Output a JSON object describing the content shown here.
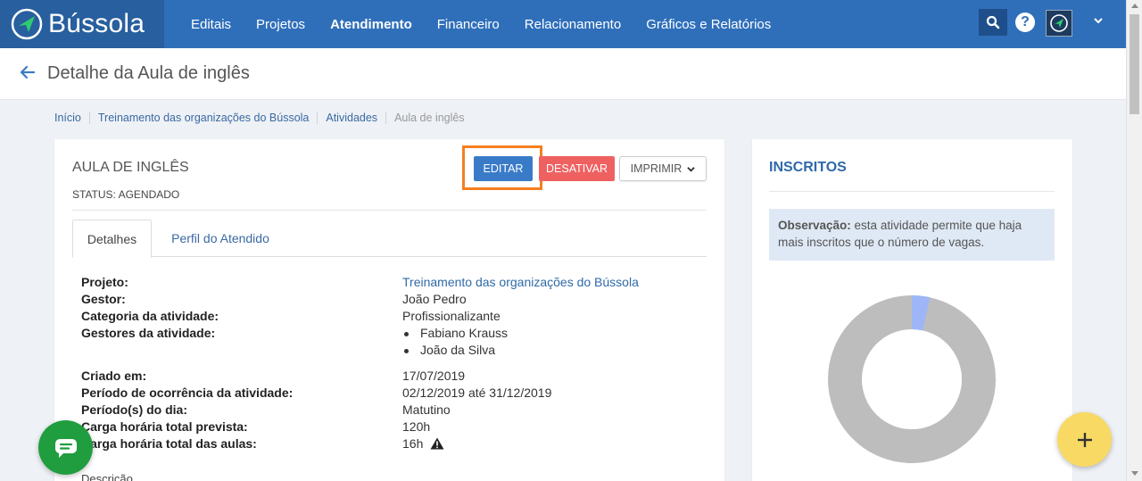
{
  "brand": {
    "name": "Bússola"
  },
  "nav": {
    "items": [
      {
        "label": "Editais"
      },
      {
        "label": "Projetos"
      },
      {
        "label": "Atendimento"
      },
      {
        "label": "Financeiro"
      },
      {
        "label": "Relacionamento"
      },
      {
        "label": "Gráficos e Relatórios"
      }
    ],
    "active": "Atendimento",
    "help_label": "?"
  },
  "page": {
    "title": "Detalhe da Aula de inglês"
  },
  "breadcrumb": [
    {
      "label": "Início"
    },
    {
      "label": "Treinamento das organizações do Bússola"
    },
    {
      "label": "Atividades"
    },
    {
      "label": "Aula de inglês"
    }
  ],
  "activity": {
    "title": "AULA DE INGLÊS",
    "status": "STATUS:  AGENDADO",
    "buttons": {
      "edit": "EDITAR",
      "deactivate": "DESATIVAR",
      "print": "IMPRIMIR"
    },
    "tabs": [
      {
        "label": "Detalhes"
      },
      {
        "label": "Perfil do Atendido"
      }
    ],
    "details": {
      "projeto": {
        "label": "Projeto:",
        "value": "Treinamento das organizações do Bússola"
      },
      "gestor": {
        "label": "Gestor:",
        "value": "João Pedro"
      },
      "categoria": {
        "label": "Categoria da atividade:",
        "value": "Profissionalizante"
      },
      "gestores": {
        "label": "Gestores da atividade:",
        "values": [
          "Fabiano Krauss",
          "João da Silva"
        ]
      },
      "criado": {
        "label": "Criado em:",
        "value": "17/07/2019"
      },
      "periodo_ocorrencia": {
        "label": "Período de ocorrência da atividade:",
        "value": "02/12/2019 até 31/12/2019"
      },
      "periodo_dia": {
        "label": "Período(s) do dia:",
        "value": "Matutino"
      },
      "carga_prevista": {
        "label": "Carga horária total prevista:",
        "value": "120h"
      },
      "carga_aulas": {
        "label": "Carga horária total das aulas:",
        "value": "16h"
      }
    },
    "description_label": "Descrição"
  },
  "inscritos": {
    "title": "INSCRITOS",
    "note_bold": "Observação:",
    "note_text": " esta atividade permite que haja mais inscritos que o número de vagas.",
    "donut_share": 0.035
  },
  "colors": {
    "nav_bg": "#2f6fba",
    "brand_bg": "#285f9e",
    "edit_btn": "#3a7bc8",
    "deactivate_btn": "#ef6161",
    "highlight": "#f57f20",
    "donut_main": "#bdbdbd",
    "donut_accent": "#9eb6f7",
    "chat_fab": "#1f9d3f",
    "add_fab": "#f8d964"
  }
}
